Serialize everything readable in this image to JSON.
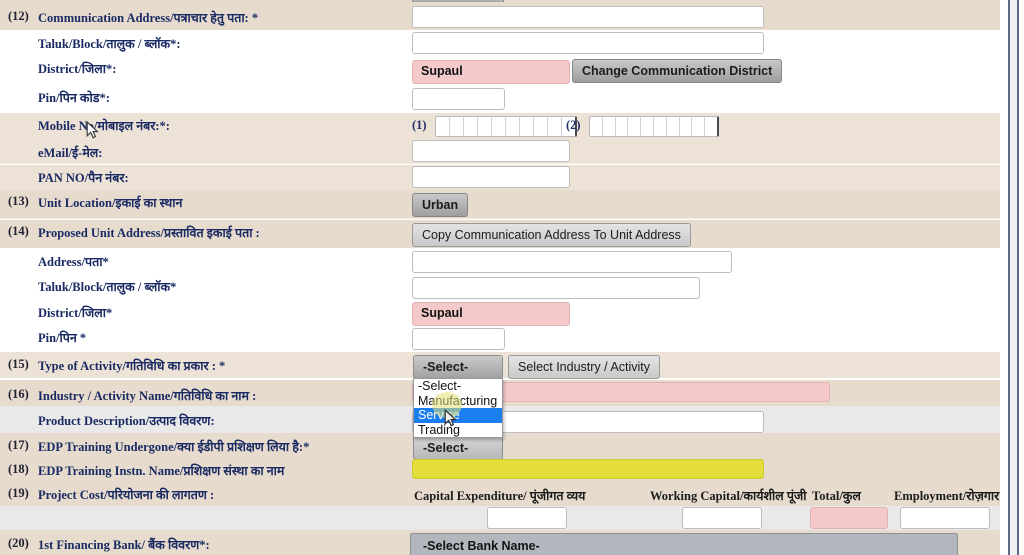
{
  "form": {
    "rows": [
      {
        "num": "(12)",
        "label": "Communication Address/पत्राचार हेतु पता: *"
      },
      {
        "num": "",
        "label": "Taluk/Block/तालुक / ब्लॉक*:"
      },
      {
        "num": "",
        "label": "District/जिला*:"
      },
      {
        "num": "",
        "label": "Pin/पिन कोड*:"
      },
      {
        "num": "",
        "label": "Mobile No/मोबाइल नंबर:*:"
      },
      {
        "num": "",
        "label": "eMail/ई-मेल:"
      },
      {
        "num": "",
        "label": "PAN NO/पैन नंबर:"
      },
      {
        "num": "(13)",
        "label": "Unit Location/इकाई का स्थान"
      },
      {
        "num": "(14)",
        "label": "Proposed Unit Address/प्रस्तावित इकाई पता :"
      },
      {
        "num": "",
        "label": "Address/पता*"
      },
      {
        "num": "",
        "label": "Taluk/Block/तालुक / ब्लॉक*"
      },
      {
        "num": "",
        "label": "District/जिला*"
      },
      {
        "num": "",
        "label": "Pin/पिन *"
      },
      {
        "num": "(15)",
        "label": "Type of Activity/गतिविधि का प्रकार : *"
      },
      {
        "num": "(16)",
        "label": "Industry / Activity Name/गतिविधि का नाम :"
      },
      {
        "num": "",
        "label": "Product Description/उत्पाद विवरण:"
      },
      {
        "num": "(17)",
        "label": "EDP Training Undergone/क्या ईडीपी प्रशिक्षण लिया है:*"
      },
      {
        "num": "(18)",
        "label": "EDP Training Instn. Name/प्रशिक्षण संस्था का नाम"
      },
      {
        "num": "(19)",
        "label": "Project Cost/परियोजना की लागतण :"
      },
      {
        "num": "(20)",
        "label": "1st Financing Bank/ बैंक विवरण*:"
      }
    ]
  },
  "values": {
    "comm_address": "",
    "comm_taluk": "",
    "comm_district": "Supaul",
    "comm_pin": "",
    "mobile1": "",
    "mobile2": "",
    "email": "",
    "pan": "",
    "unit_address": "",
    "unit_taluk": "",
    "unit_district": "Supaul",
    "unit_pin": "",
    "industry_name": "",
    "product_description": "",
    "edp_instn_name": "",
    "capital_expenditure": "",
    "working_capital": "",
    "total": "",
    "employment": ""
  },
  "buttons": {
    "change_comm_district": "Change Communication District",
    "unit_location": "Urban",
    "copy_comm_address": "Copy Communication Address To Unit Address",
    "select_industry_activity": "Select Industry / Activity"
  },
  "selects": {
    "type_of_activity": {
      "selected": "-Select-",
      "open": true,
      "options": [
        "-Select-",
        "Manufacturing",
        "Service",
        "Trading"
      ],
      "highlighted": "Service"
    },
    "edp_training": {
      "selected": "-Select-"
    },
    "bank_name": {
      "selected": "-Select Bank Name-"
    }
  },
  "mobile": {
    "group1_label": "(1)",
    "group2_label": "(2)",
    "cells": 10
  },
  "project_cost": {
    "headers": [
      "Capital Expenditure/ पूंजीगत व्यय",
      "Working Capital/कार्यशील पूंजी",
      "Total/कुल",
      "Employment/रोज़गार"
    ]
  },
  "colors": {
    "band_beige": "#e6dbcd",
    "band_beige_light": "#ede2d6",
    "required_pink": "#f4c9c9",
    "highlight_yellow": "#e3de3a",
    "dropdown_selected": "#1a7ef0",
    "label_blue": "#1a2a63"
  }
}
